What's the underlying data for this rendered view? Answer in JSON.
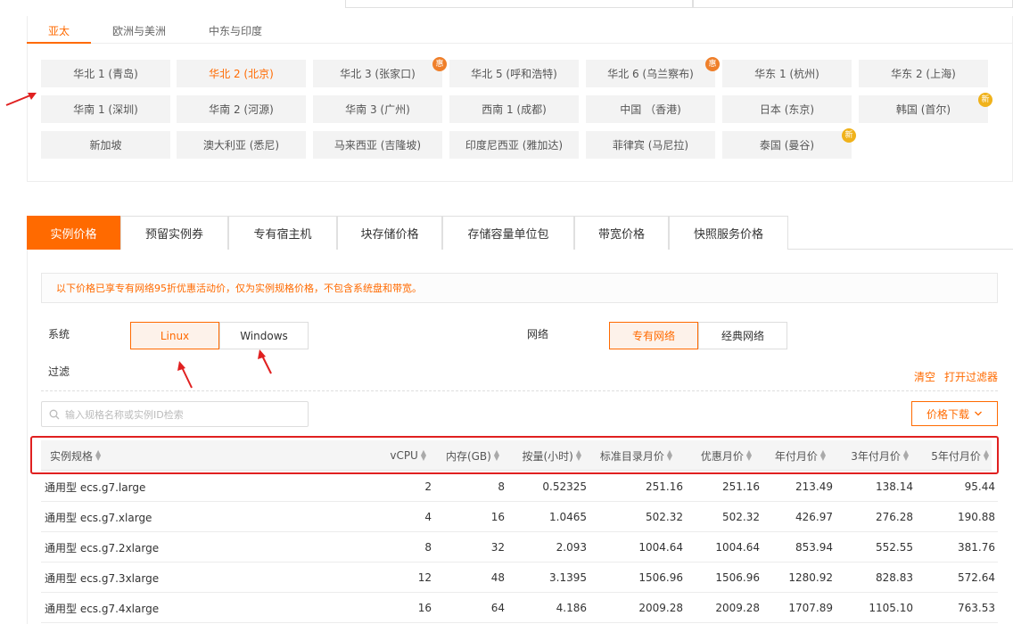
{
  "region_tabs": [
    {
      "label": "亚太",
      "active": true
    },
    {
      "label": "欧洲与美洲",
      "active": false
    },
    {
      "label": "中东与印度",
      "active": false
    }
  ],
  "regions": [
    {
      "label": "华北 1 (青岛)",
      "active": false,
      "badge": ""
    },
    {
      "label": "华北 2 (北京)",
      "active": true,
      "badge": ""
    },
    {
      "label": "华北 3 (张家口)",
      "active": false,
      "badge": "惠"
    },
    {
      "label": "华北 5 (呼和浩特)",
      "active": false,
      "badge": ""
    },
    {
      "label": "华北 6 (乌兰察布)",
      "active": false,
      "badge": "惠"
    },
    {
      "label": "华东 1 (杭州)",
      "active": false,
      "badge": ""
    },
    {
      "label": "华东 2 (上海)",
      "active": false,
      "badge": ""
    },
    {
      "label": "华南 1 (深圳)",
      "active": false,
      "badge": ""
    },
    {
      "label": "华南 2 (河源)",
      "active": false,
      "badge": ""
    },
    {
      "label": "华南 3 (广州)",
      "active": false,
      "badge": ""
    },
    {
      "label": "西南 1 (成都)",
      "active": false,
      "badge": ""
    },
    {
      "label": "中国 （香港)",
      "active": false,
      "badge": ""
    },
    {
      "label": "日本 (东京)",
      "active": false,
      "badge": ""
    },
    {
      "label": "韩国 (首尔)",
      "active": false,
      "badge": "新"
    },
    {
      "label": "新加坡",
      "active": false,
      "badge": ""
    },
    {
      "label": "澳大利亚 (悉尼)",
      "active": false,
      "badge": ""
    },
    {
      "label": "马来西亚 (吉隆坡)",
      "active": false,
      "badge": ""
    },
    {
      "label": "印度尼西亚 (雅加达)",
      "active": false,
      "badge": ""
    },
    {
      "label": "菲律宾 (马尼拉)",
      "active": false,
      "badge": ""
    },
    {
      "label": "泰国 (曼谷)",
      "active": false,
      "badge": "新"
    }
  ],
  "price_tabs": [
    {
      "label": "实例价格",
      "active": true
    },
    {
      "label": "预留实例券",
      "active": false
    },
    {
      "label": "专有宿主机",
      "active": false
    },
    {
      "label": "块存储价格",
      "active": false
    },
    {
      "label": "存储容量单位包",
      "active": false
    },
    {
      "label": "带宽价格",
      "active": false
    },
    {
      "label": "快照服务价格",
      "active": false
    }
  ],
  "notice": "以下价格已享专有网络95折优惠活动价，仅为实例规格价格，不包含系统盘和带宽。",
  "filters": {
    "system_label": "系统",
    "os_options": [
      {
        "label": "Linux",
        "active": true
      },
      {
        "label": "Windows",
        "active": false
      }
    ],
    "network_label": "网络",
    "network_options": [
      {
        "label": "专有网络",
        "active": true
      },
      {
        "label": "经典网络",
        "active": false
      }
    ],
    "filter_label": "过滤",
    "clear": "清空",
    "open_filter": "打开过滤器"
  },
  "search": {
    "placeholder": "输入规格名称或实例ID检索"
  },
  "download": {
    "label": "价格下载"
  },
  "table": {
    "headers": [
      "实例规格",
      "vCPU",
      "内存(GB)",
      "按量(小时)",
      "标准目录月价",
      "优惠月价",
      "年付月价",
      "3年付月价",
      "5年付月价"
    ],
    "rows": [
      [
        "通用型 ecs.g7.large",
        "2",
        "8",
        "0.52325",
        "251.16",
        "251.16",
        "213.49",
        "138.14",
        "95.44"
      ],
      [
        "通用型 ecs.g7.xlarge",
        "4",
        "16",
        "1.0465",
        "502.32",
        "502.32",
        "426.97",
        "276.28",
        "190.88"
      ],
      [
        "通用型 ecs.g7.2xlarge",
        "8",
        "32",
        "2.093",
        "1004.64",
        "1004.64",
        "853.94",
        "552.55",
        "381.76"
      ],
      [
        "通用型 ecs.g7.3xlarge",
        "12",
        "48",
        "3.1395",
        "1506.96",
        "1506.96",
        "1280.92",
        "828.83",
        "572.64"
      ],
      [
        "通用型 ecs.g7.4xlarge",
        "16",
        "64",
        "4.186",
        "2009.28",
        "2009.28",
        "1707.89",
        "1105.10",
        "763.53"
      ]
    ]
  },
  "colors": {
    "accent": "#ff6a00",
    "annotation_red": "#e02020"
  }
}
